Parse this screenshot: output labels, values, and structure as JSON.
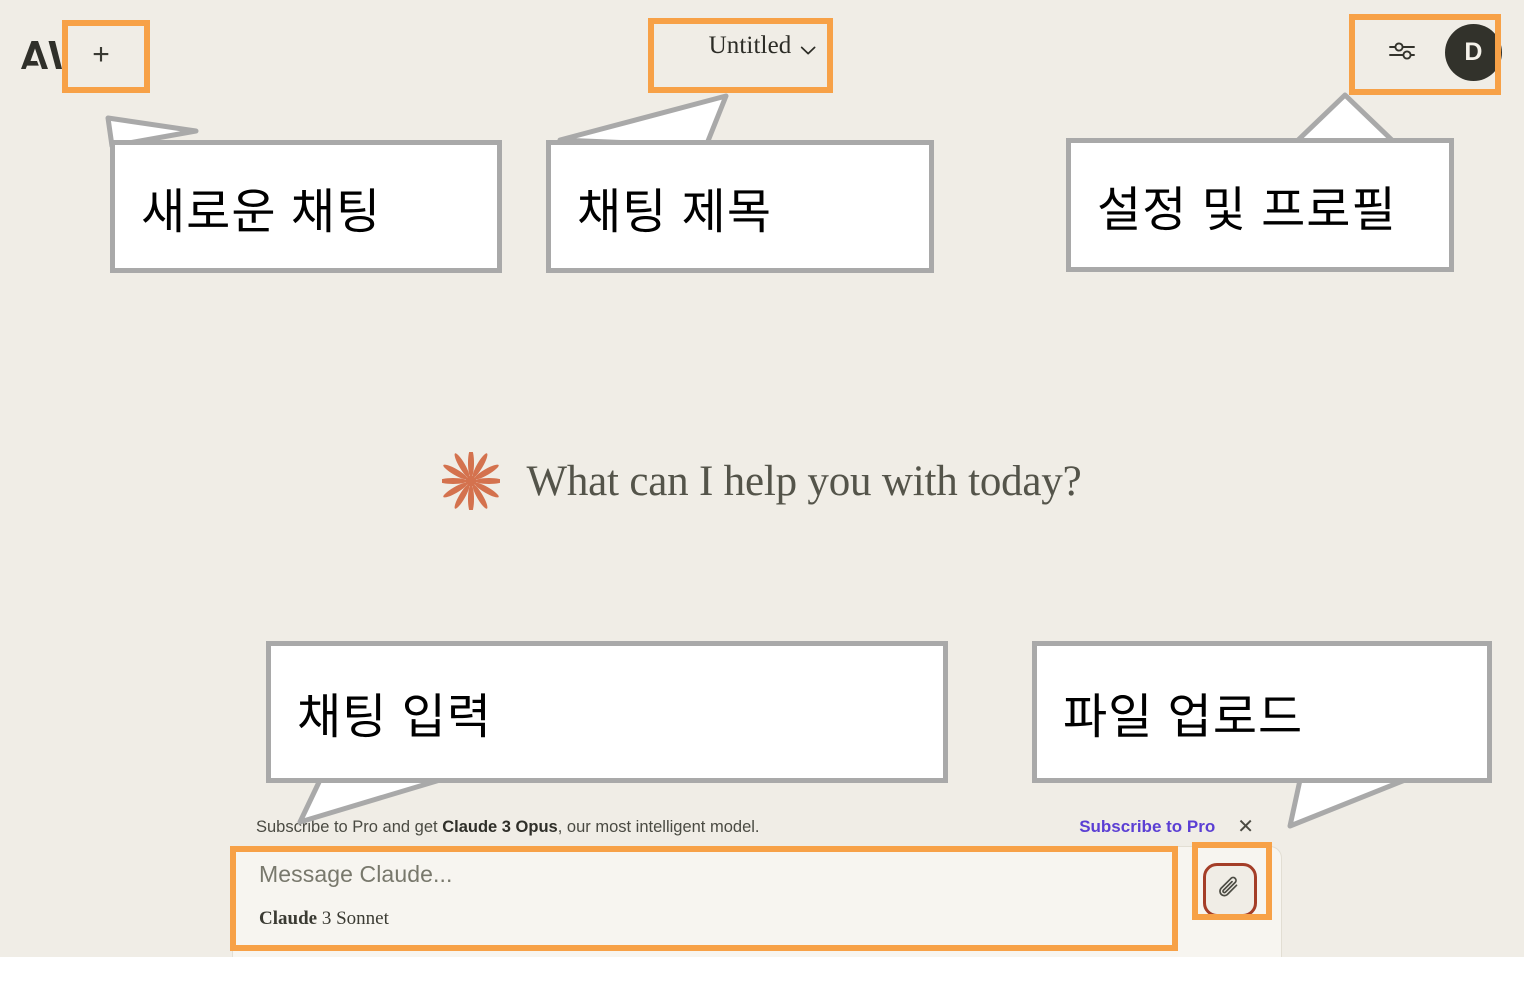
{
  "app": {
    "name": "Claude",
    "logo_icon": "anthropic-logo-icon",
    "background_color": "#F0EDE6"
  },
  "topbar": {
    "new_chat_label": "+",
    "new_chat_icon": "plus-icon",
    "chat_title": "Untitled",
    "chat_title_caret_icon": "chevron-down-icon",
    "settings_icon": "sliders-icon",
    "avatar_initial": "D"
  },
  "main": {
    "greeting": "What can I help you with today?",
    "greeting_icon": "claude-starburst-icon",
    "greeting_icon_color": "#D4724E"
  },
  "composer": {
    "promo_prefix": "Subscribe to Pro and get ",
    "promo_bold": "Claude 3 Opus",
    "promo_suffix": ", our most intelligent model.",
    "promo_link": "Subscribe to Pro",
    "promo_link_color": "#5B3FD4",
    "promo_close_icon": "close-icon",
    "input_placeholder": "Message Claude...",
    "model_name_bold": "Claude",
    "model_name_rest": " 3 Sonnet",
    "attach_icon": "paperclip-icon",
    "attach_border_color": "#A43E28"
  },
  "annotations": {
    "highlight_color": "#F7A147",
    "callout_border_color": "#A9A9A9",
    "items": [
      {
        "id": "new-chat",
        "label": "새로운 채팅"
      },
      {
        "id": "chat-title",
        "label": "채팅 제목"
      },
      {
        "id": "settings",
        "label": "설정 및 프로필"
      },
      {
        "id": "chat-input",
        "label": "채팅 입력"
      },
      {
        "id": "file-upload",
        "label": "파일 업로드"
      }
    ]
  }
}
